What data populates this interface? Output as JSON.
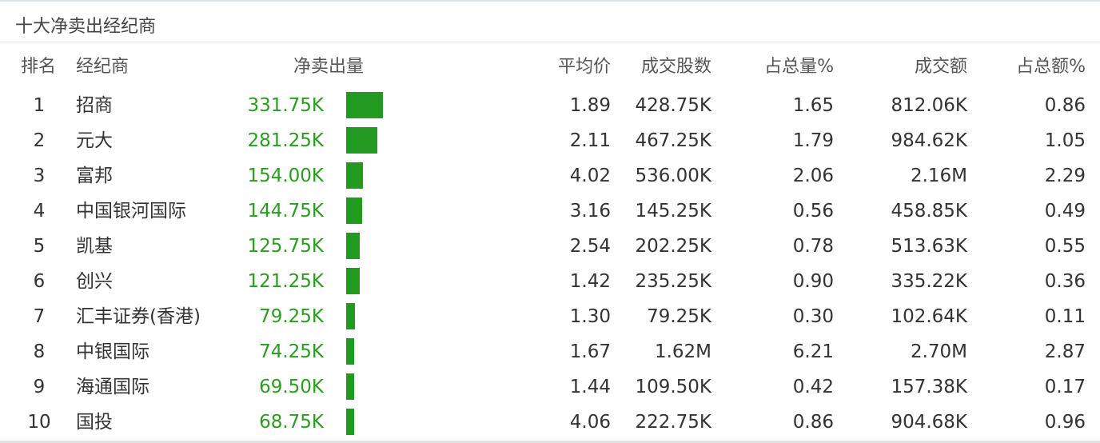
{
  "panel": {
    "title": "十大净卖出经纪商"
  },
  "table": {
    "headers": {
      "rank": "排名",
      "broker": "经纪商",
      "net_sell": "净卖出量",
      "avg_price": "平均价",
      "volume": "成交股数",
      "volume_pct": "占总量%",
      "amount": "成交额",
      "amount_pct": "占总额%"
    },
    "colors": {
      "net_text": "#2a9d1f",
      "bar": "#229a1f"
    },
    "rows": [
      {
        "rank": "1",
        "broker": "招商",
        "net_sell": "331.75K",
        "net_value": 331.75,
        "avg_price": "1.89",
        "volume": "428.75K",
        "volume_pct": "1.65",
        "amount": "812.06K",
        "amount_pct": "0.86"
      },
      {
        "rank": "2",
        "broker": "元大",
        "net_sell": "281.25K",
        "net_value": 281.25,
        "avg_price": "2.11",
        "volume": "467.25K",
        "volume_pct": "1.79",
        "amount": "984.62K",
        "amount_pct": "1.05"
      },
      {
        "rank": "3",
        "broker": "富邦",
        "net_sell": "154.00K",
        "net_value": 154.0,
        "avg_price": "4.02",
        "volume": "536.00K",
        "volume_pct": "2.06",
        "amount": "2.16M",
        "amount_pct": "2.29"
      },
      {
        "rank": "4",
        "broker": "中国银河国际",
        "net_sell": "144.75K",
        "net_value": 144.75,
        "avg_price": "3.16",
        "volume": "145.25K",
        "volume_pct": "0.56",
        "amount": "458.85K",
        "amount_pct": "0.49"
      },
      {
        "rank": "5",
        "broker": "凯基",
        "net_sell": "125.75K",
        "net_value": 125.75,
        "avg_price": "2.54",
        "volume": "202.25K",
        "volume_pct": "0.78",
        "amount": "513.63K",
        "amount_pct": "0.55"
      },
      {
        "rank": "6",
        "broker": "创兴",
        "net_sell": "121.25K",
        "net_value": 121.25,
        "avg_price": "1.42",
        "volume": "235.25K",
        "volume_pct": "0.90",
        "amount": "335.22K",
        "amount_pct": "0.36"
      },
      {
        "rank": "7",
        "broker": "汇丰证券(香港)",
        "net_sell": "79.25K",
        "net_value": 79.25,
        "avg_price": "1.30",
        "volume": "79.25K",
        "volume_pct": "0.30",
        "amount": "102.64K",
        "amount_pct": "0.11"
      },
      {
        "rank": "8",
        "broker": "中银国际",
        "net_sell": "74.25K",
        "net_value": 74.25,
        "avg_price": "1.67",
        "volume": "1.62M",
        "volume_pct": "6.21",
        "amount": "2.70M",
        "amount_pct": "2.87"
      },
      {
        "rank": "9",
        "broker": "海通国际",
        "net_sell": "69.50K",
        "net_value": 69.5,
        "avg_price": "1.44",
        "volume": "109.50K",
        "volume_pct": "0.42",
        "amount": "157.38K",
        "amount_pct": "0.17"
      },
      {
        "rank": "10",
        "broker": "国投",
        "net_sell": "68.75K",
        "net_value": 68.75,
        "avg_price": "4.06",
        "volume": "222.75K",
        "volume_pct": "0.86",
        "amount": "904.68K",
        "amount_pct": "0.96"
      }
    ]
  }
}
